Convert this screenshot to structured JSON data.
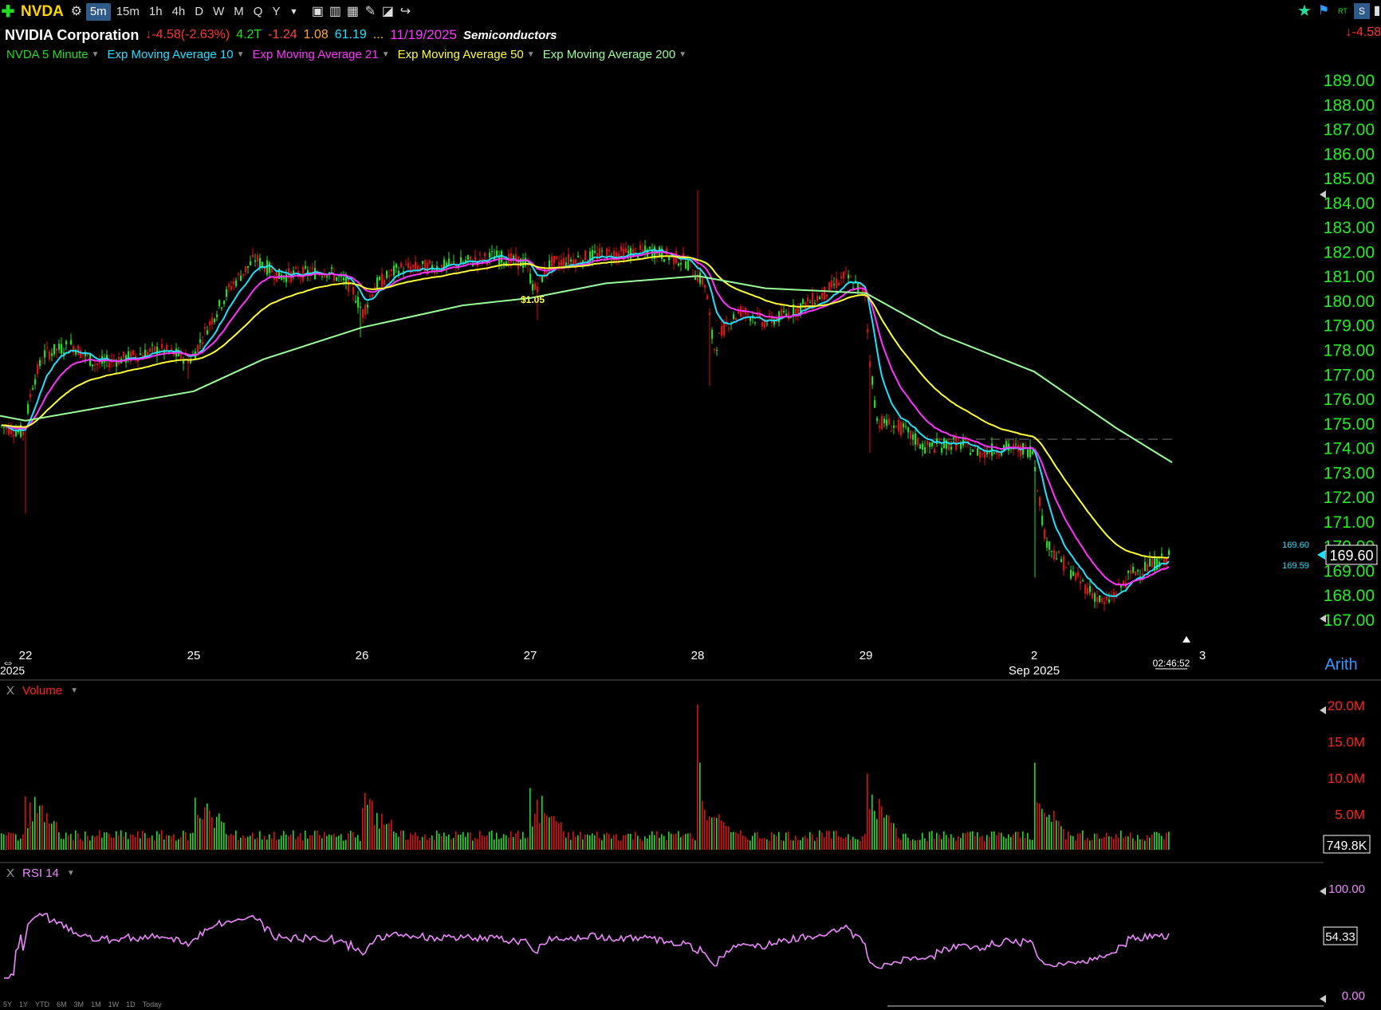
{
  "toolbar": {
    "add_icon": "plus-icon",
    "symbol": "NVDA",
    "intervals": [
      "5m",
      "15m",
      "1h",
      "4h",
      "D",
      "W",
      "M",
      "Q",
      "Y"
    ],
    "active_interval": "5m"
  },
  "info": {
    "company": "NVIDIA Corporation",
    "change": "-4.58",
    "change_pct": "(-2.63%)",
    "market_cap": "4.2T",
    "v1": "-1.24",
    "v2": "1.08",
    "v3": "61.19",
    "dots": "...",
    "date": "11/19/2025",
    "sector": "Semiconductors",
    "right_change": "-4.58"
  },
  "legend": {
    "main": "NVDA 5 Minute",
    "ema10": "Exp Moving Average 10",
    "ema21": "Exp Moving Average 21",
    "ema50": "Exp Moving Average 50",
    "ema200": "Exp Moving Average 200"
  },
  "colors": {
    "up": "#22dd22",
    "down": "#dd1111",
    "ema10": "#22e0ff",
    "ema21": "#ff33ff",
    "ema50": "#ffff33",
    "ema200": "#99ff99",
    "rsi": "#ee88ff",
    "axis_green": "#22ee22"
  },
  "price_axis": {
    "ticks": [
      "189.00",
      "188.00",
      "187.00",
      "186.00",
      "185.00",
      "184.00",
      "183.00",
      "182.00",
      "181.00",
      "180.00",
      "179.00",
      "178.00",
      "177.00",
      "176.00",
      "175.00",
      "174.00",
      "173.00",
      "172.00",
      "171.00",
      "170.00",
      "169.00",
      "168.00",
      "167.00"
    ],
    "last_price": "169.60",
    "ema_label_1": "169.60",
    "ema_label_2": "169.59",
    "scale": "Arith"
  },
  "time_axis": {
    "labels": [
      "22",
      "25",
      "26",
      "27",
      "28",
      "29",
      "2",
      "3"
    ],
    "month_label": "Sep 2025",
    "left_year": "2025",
    "clock": "02:46:52"
  },
  "annotation": "$1.05",
  "volume": {
    "label": "Volume",
    "ticks": [
      "20.0M",
      "15.0M",
      "10.0M",
      "5.0M"
    ],
    "last": "749.8K"
  },
  "rsi": {
    "label": "RSI 14",
    "ticks": [
      "100.00",
      "0.00"
    ],
    "last": "54.33"
  },
  "range_buttons": [
    "5Y",
    "1Y",
    "YTD",
    "6M",
    "3M",
    "1M",
    "1W",
    "1D",
    "Today"
  ],
  "chart_data": {
    "type": "line",
    "title": "",
    "x": [
      "Aug 22",
      "Aug 25",
      "Aug 26",
      "Aug 27",
      "Aug 28",
      "Aug 29",
      "Sep 2",
      "Sep 3"
    ],
    "ylim": [
      166.5,
      189.5
    ],
    "series": [
      {
        "name": "NVDA 5 Minute",
        "values": [
          174.9,
          178.0,
          181.0,
          181.6,
          181.8,
          180.3,
          173.9,
          169.6
        ]
      },
      {
        "name": "Exp Moving Average 10",
        "values": [
          174.8,
          177.9,
          180.6,
          181.3,
          181.7,
          180.4,
          174.0,
          169.6
        ]
      },
      {
        "name": "Exp Moving Average 21",
        "values": [
          174.6,
          177.8,
          180.4,
          181.1,
          181.6,
          180.4,
          174.1,
          169.5
        ]
      },
      {
        "name": "Exp Moving Average 50",
        "values": [
          174.5,
          177.5,
          180.0,
          180.9,
          181.5,
          180.3,
          174.4,
          169.6
        ]
      },
      {
        "name": "Exp Moving Average 200",
        "values": [
          175.3,
          176.3,
          178.7,
          180.0,
          181.0,
          180.4,
          177.1,
          173.4
        ]
      }
    ],
    "volume_ylim": [
      0,
      20000000
    ],
    "rsi_ylim": [
      0,
      100
    ]
  }
}
